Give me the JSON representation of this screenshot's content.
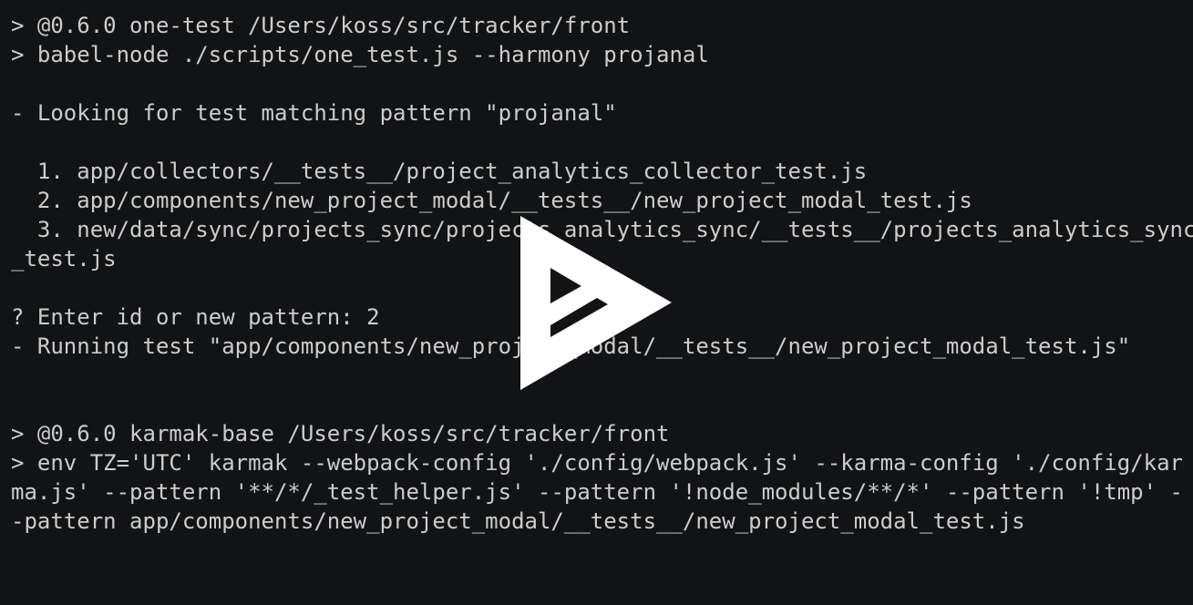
{
  "terminal": {
    "lines": [
      "> @0.6.0 one-test /Users/koss/src/tracker/front",
      "> babel-node ./scripts/one_test.js --harmony projanal",
      "",
      "- Looking for test matching pattern \"projanal\"",
      "",
      "  1. app/collectors/__tests__/project_analytics_collector_test.js",
      "  2. app/components/new_project_modal/__tests__/new_project_modal_test.js",
      "  3. new/data/sync/projects_sync/projects_analytics_sync/__tests__/projects_analytics_sync",
      "_test.js",
      "",
      "? Enter id or new pattern: 2",
      "- Running test \"app/components/new_project_modal/__tests__/new_project_modal_test.js\"",
      "",
      "",
      "> @0.6.0 karmak-base /Users/koss/src/tracker/front",
      "> env TZ='UTC' karmak --webpack-config './config/webpack.js' --karma-config './config/kar",
      "ma.js' --pattern '**/*/_test_helper.js' --pattern '!node_modules/**/*' --pattern '!tmp' -",
      "-pattern app/components/new_project_modal/__tests__/new_project_modal_test.js"
    ]
  },
  "overlay": {
    "icon": "asciinema-play-icon"
  },
  "colors": {
    "background": "#121314",
    "foreground": "#cccccc",
    "overlay_icon": "#ffffff"
  }
}
